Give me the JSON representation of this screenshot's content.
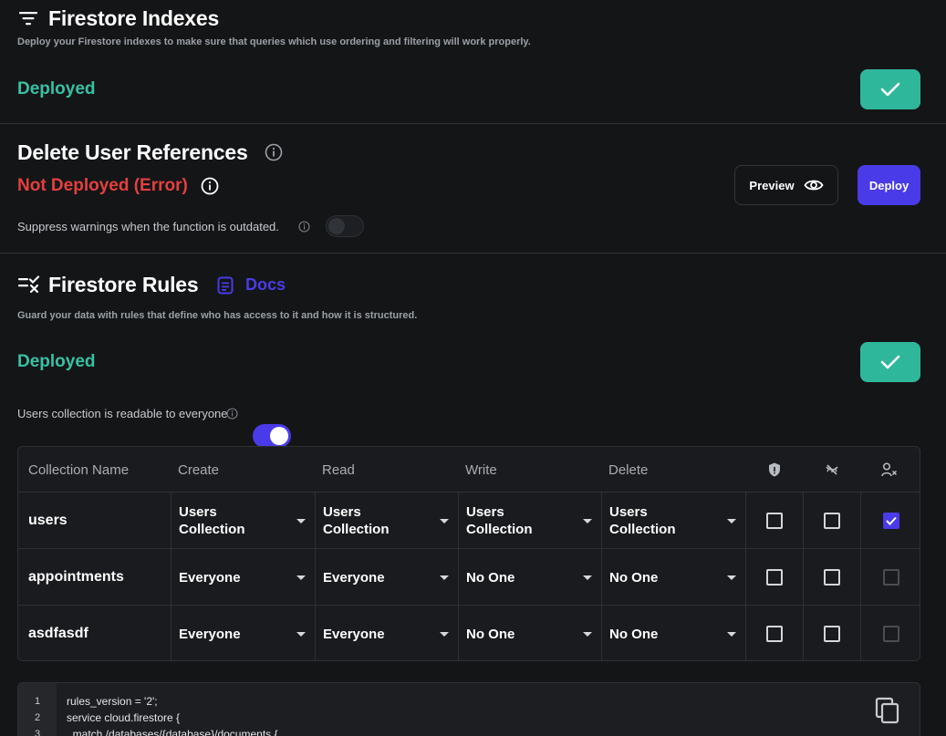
{
  "indexes": {
    "title": "Firestore Indexes",
    "description": "Deploy your Firestore indexes to make sure that queries which use ordering and filtering will work properly.",
    "status": "Deployed",
    "status_color": "#37c1a3"
  },
  "delete_refs": {
    "title": "Delete User References",
    "status": "Not Deployed (Error)",
    "status_color": "#e3403f",
    "preview_label": "Preview",
    "deploy_label": "Deploy",
    "suppress_label": "Suppress warnings when the function is outdated.",
    "suppress_enabled": false
  },
  "rules": {
    "title": "Firestore Rules",
    "docs_label": "Docs",
    "description": "Guard your data with rules that define who has access to it and how it is structured.",
    "status": "Deployed",
    "users_readable_label": "Users collection is readable to everyone",
    "users_readable_enabled": true
  },
  "table": {
    "headers": [
      "Collection Name",
      "Create",
      "Read",
      "Write",
      "Delete"
    ],
    "icon_headers": [
      "shield-icon",
      "hidden-icon",
      "user-remove-icon"
    ],
    "rows": [
      {
        "name": "users",
        "create": "Users Collection",
        "read": "Users Collection",
        "write": "Users Collection",
        "delete": "Users Collection",
        "checks": [
          false,
          false,
          true
        ],
        "third_dim": false
      },
      {
        "name": "appointments",
        "create": "Everyone",
        "read": "Everyone",
        "write": "No One",
        "delete": "No One",
        "checks": [
          false,
          false,
          false
        ],
        "third_dim": true
      },
      {
        "name": "asdfasdf",
        "create": "Everyone",
        "read": "Everyone",
        "write": "No One",
        "delete": "No One",
        "checks": [
          false,
          false,
          false
        ],
        "third_dim": true
      }
    ]
  },
  "code": {
    "line_numbers": [
      "1",
      "2",
      "3"
    ],
    "lines": [
      "rules_version = '2';",
      "service cloud.firestore {",
      "  match /databases/{database}/documents {"
    ]
  },
  "colors": {
    "accent": "#4a3be8",
    "success_button": "#2fb79c",
    "background": "#141517"
  }
}
